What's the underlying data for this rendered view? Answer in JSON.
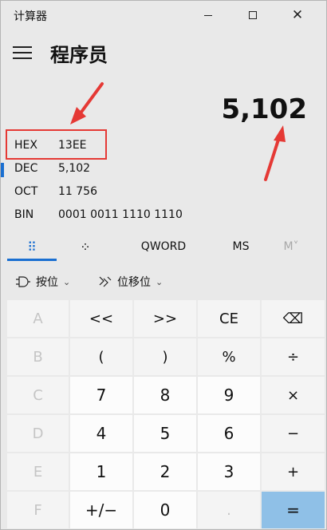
{
  "window": {
    "title": "计算器",
    "controls": {
      "minimize": "—",
      "maximize": "□",
      "close": "✕"
    }
  },
  "header": {
    "mode_title": "程序员",
    "display_value": "5,102"
  },
  "radix": {
    "hex": {
      "name": "HEX",
      "value": "13EE"
    },
    "dec": {
      "name": "DEC",
      "value": "5,102"
    },
    "oct": {
      "name": "OCT",
      "value": "11 756"
    },
    "bin": {
      "name": "BIN",
      "value": "0001 0011 1110 1110"
    }
  },
  "tabs": {
    "keypad_icon": "⠿",
    "bits_icon": "⁘",
    "word": "QWORD",
    "ms": "MS",
    "m_dropdown": "M˅"
  },
  "bitwise": {
    "and_label": "按位",
    "shift_label": "位移位"
  },
  "keypad": {
    "row1": [
      "A",
      "<<",
      ">>",
      "CE",
      "⌫"
    ],
    "row2": [
      "B",
      "(",
      ")",
      "%",
      "÷"
    ],
    "row3": [
      "C",
      "7",
      "8",
      "9",
      "×"
    ],
    "row4": [
      "D",
      "4",
      "5",
      "6",
      "−"
    ],
    "row5": [
      "E",
      "1",
      "2",
      "3",
      "+"
    ],
    "row6": [
      "F",
      "+/−",
      "0",
      ".",
      "="
    ]
  },
  "colors": {
    "accent": "#1a6fd1",
    "annotation": "#e53935",
    "equals_key": "#8fc0e7"
  }
}
